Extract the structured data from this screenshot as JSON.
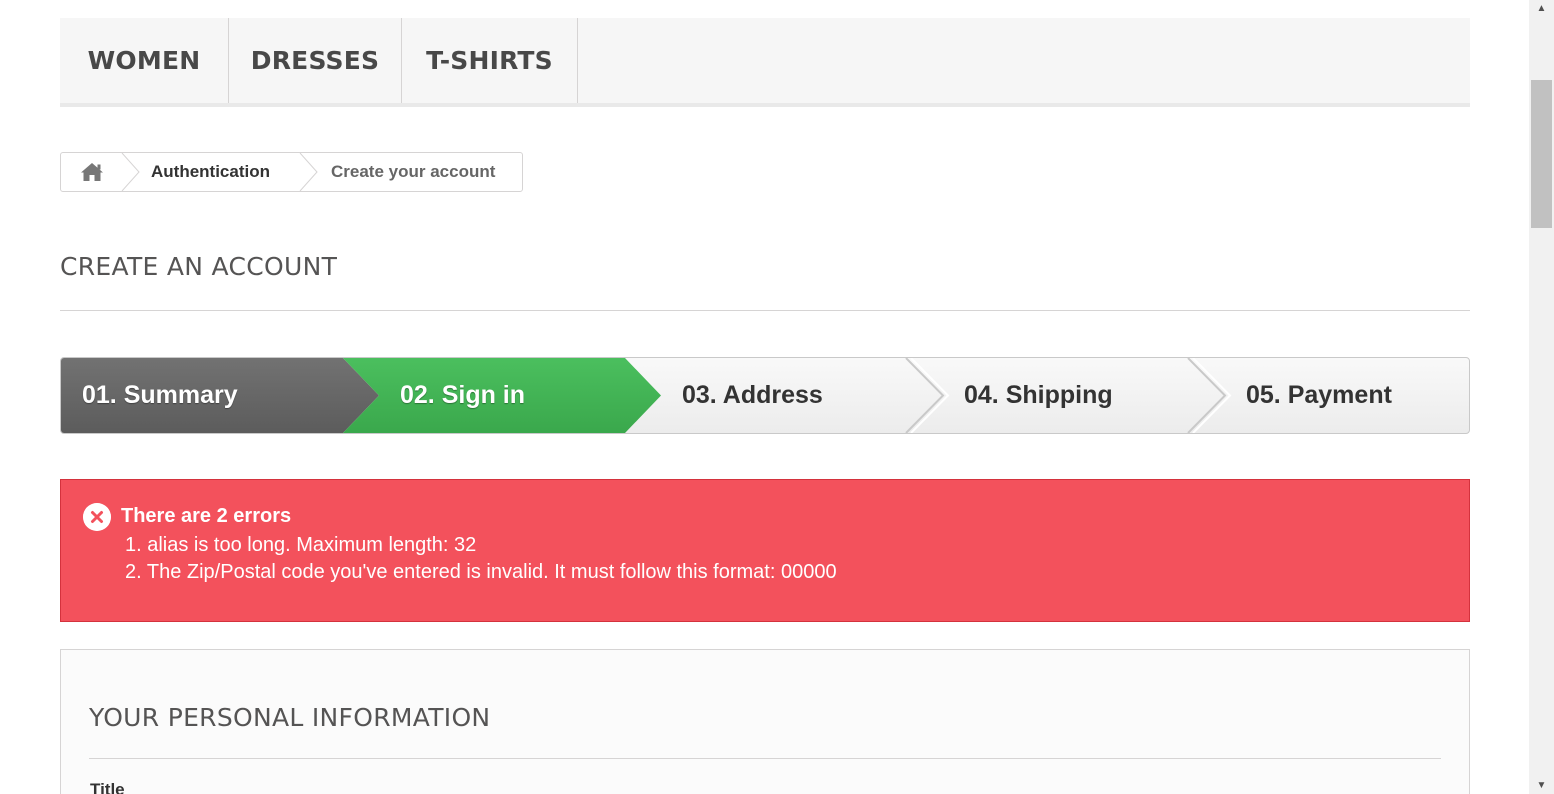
{
  "menu": {
    "items": [
      "WOMEN",
      "DRESSES",
      "T-SHIRTS"
    ]
  },
  "breadcrumb": {
    "home_icon": "home-icon",
    "items": [
      "Authentication",
      "Create your account"
    ]
  },
  "page": {
    "heading": "CREATE AN ACCOUNT"
  },
  "steps": {
    "items": [
      "01. Summary",
      "02. Sign in",
      "03. Address",
      "04. Shipping",
      "05. Payment"
    ],
    "active_index": 1,
    "colors": {
      "done": "#666666",
      "active": "#43b155"
    }
  },
  "alert": {
    "icon": "error-x-icon",
    "color": "#f3515c",
    "title": "There are 2 errors",
    "errors": [
      "1. alias is too long. Maximum length: 32",
      "2. The Zip/Postal code you've entered is invalid. It must follow this format: 00000"
    ]
  },
  "personal_info": {
    "heading": "YOUR PERSONAL INFORMATION",
    "title_label": "Title"
  }
}
